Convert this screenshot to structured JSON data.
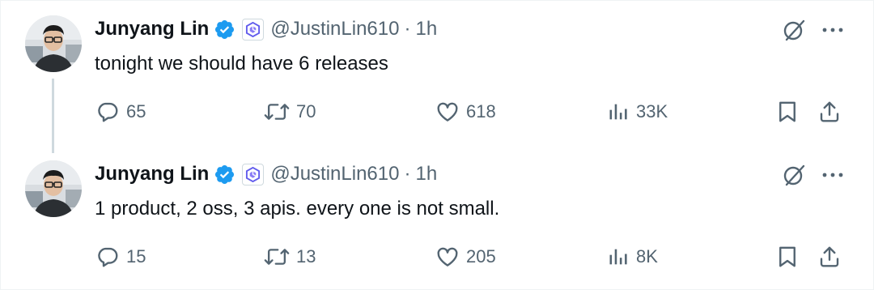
{
  "colors": {
    "verified": "#1d9bf0",
    "muted": "#536471",
    "text": "#0f1419",
    "thread_line": "#cfd9de",
    "affiliation": "#615ced"
  },
  "tweets": [
    {
      "name": "Junyang Lin",
      "handle": "@JustinLin610",
      "separator": "·",
      "time": "1h",
      "text": "tonight we should have 6 releases",
      "replies": "65",
      "retweets": "70",
      "likes": "618",
      "views": "33K"
    },
    {
      "name": "Junyang Lin",
      "handle": "@JustinLin610",
      "separator": "·",
      "time": "1h",
      "text": "1 product, 2 oss, 3 apis. every one is not small.",
      "replies": "15",
      "retweets": "13",
      "likes": "205",
      "views": "8K"
    }
  ],
  "icons": {
    "verified": "verified-badge-icon",
    "affiliation": "qwen-logo-icon",
    "grok": "grok-icon",
    "more": "more-icon",
    "reply": "reply-icon",
    "retweet": "retweet-icon",
    "like": "heart-icon",
    "views": "views-icon",
    "bookmark": "bookmark-icon",
    "share": "share-icon"
  }
}
